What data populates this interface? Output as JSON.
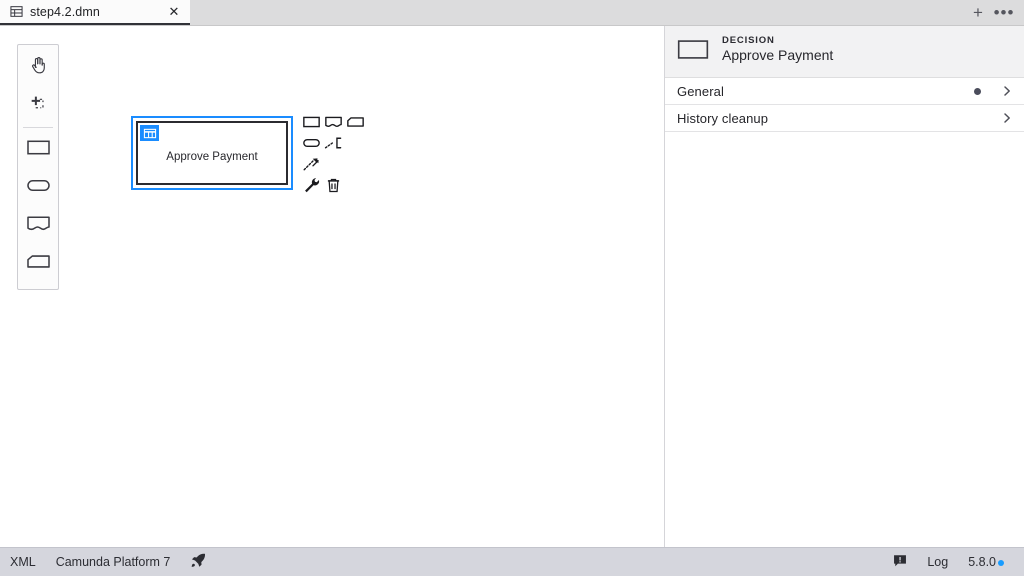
{
  "window": {
    "title": "step4.2.dmn"
  },
  "tabbar": {
    "tabs": [
      {
        "label": "step4.2.dmn",
        "icon": "dmn-table-icon",
        "close_label": "✕",
        "active": true
      }
    ],
    "add_button": {
      "label": "+",
      "icon": "plus-icon"
    },
    "more_button": {
      "label": "•••",
      "icon": "ellipsis-icon"
    }
  },
  "palette": {
    "tools": [
      {
        "name": "hand-tool",
        "icon": "hand-icon"
      },
      {
        "name": "lasso-tool",
        "icon": "lasso-select-icon"
      }
    ],
    "elements": [
      {
        "name": "create-decision",
        "icon": "decision-rectangle-icon"
      },
      {
        "name": "create-input-data",
        "icon": "input-data-stadium-icon"
      },
      {
        "name": "create-knowledge-source",
        "icon": "knowledge-source-icon"
      },
      {
        "name": "create-business-knowledge-model",
        "icon": "business-knowledge-model-icon"
      }
    ]
  },
  "canvas": {
    "element": {
      "label": "Approve Payment",
      "type": "decision",
      "selected": true,
      "type_icon": "decision-table-icon",
      "selection_color": "#1a8cff",
      "border_color": "#2b2b30"
    },
    "context_pad": [
      {
        "name": "append-decision",
        "icon": "decision-rectangle-icon"
      },
      {
        "name": "append-knowledge-source",
        "icon": "knowledge-source-icon"
      },
      {
        "name": "append-business-knowledge-model",
        "icon": "business-knowledge-model-icon"
      },
      {
        "name": "append-input-data",
        "icon": "input-data-stadium-icon"
      },
      {
        "name": "append-text-annotation",
        "icon": "text-annotation-icon"
      },
      {
        "name": "connect",
        "icon": "connect-arrow-icon"
      },
      {
        "name": "change-type",
        "icon": "wrench-icon"
      },
      {
        "name": "delete",
        "icon": "trash-icon"
      }
    ]
  },
  "properties": {
    "header": {
      "type": "DECISION",
      "name": "Approve Payment",
      "icon": "decision-rectangle-icon"
    },
    "groups": [
      {
        "label": "General",
        "has_dot": true,
        "chevron": "chevron-right-icon"
      },
      {
        "label": "History cleanup",
        "has_dot": false,
        "chevron": "chevron-right-icon"
      }
    ]
  },
  "statusbar": {
    "xml_label": "XML",
    "platform_label": "Camunda Platform 7",
    "deploy_icon": "rocket-icon",
    "alert_icon": "alert-icon",
    "log_label": "Log",
    "version_label": "5.8.0",
    "version_dot_color": "#189cff"
  }
}
